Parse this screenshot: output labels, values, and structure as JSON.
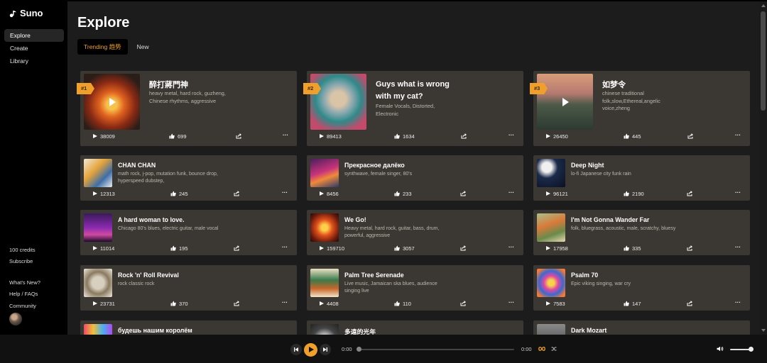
{
  "app": {
    "name": "Suno"
  },
  "sidebar": {
    "nav": [
      {
        "label": "Explore",
        "active": true
      },
      {
        "label": "Create",
        "active": false
      },
      {
        "label": "Library",
        "active": false
      }
    ],
    "credits": "100 credits",
    "subscribe": "Subscribe",
    "links": [
      "What's New?",
      "Help / FAQs",
      "Community"
    ]
  },
  "page": {
    "title": "Explore",
    "tabs": [
      {
        "label": "Trending 趋势",
        "active": true
      },
      {
        "label": "New",
        "active": false
      }
    ]
  },
  "featured": [
    {
      "rank": "#1",
      "title": "醉打蔣門神",
      "tags": [
        "heavy metal, hard rock, guzheng,",
        "Chinese rhythms, aggressive"
      ],
      "plays": "38009",
      "likes": "699"
    },
    {
      "rank": "#2",
      "title_lines": [
        "Guys what is wrong",
        "with my cat?"
      ],
      "tags": [
        "Female Vocals, Distorted,",
        "Electronic"
      ],
      "plays": "89413",
      "likes": "1634"
    },
    {
      "rank": "#3",
      "title": "如梦令",
      "tags": [
        "chinese traditional",
        "folk,slow,Ethereal,angelic",
        "voice,zheng"
      ],
      "plays": "26450",
      "likes": "445"
    }
  ],
  "songs": [
    {
      "title": "CHAN CHAN",
      "tags": [
        "math rock, j-pop, mutation funk, bounce drop,",
        "hyperspeed dubstep,"
      ],
      "plays": "12313",
      "likes": "245"
    },
    {
      "title": "Прекрасное далёко",
      "tags": [
        "synthwave, female singer, 80's"
      ],
      "plays": "8456",
      "likes": "233"
    },
    {
      "title": "Deep Night",
      "tags": [
        "lo-fi Japanese city funk rain"
      ],
      "plays": "96121",
      "likes": "2190"
    },
    {
      "title": "A hard woman to love.",
      "tags": [
        "Chicago 80's blues, electric guitar, male vocal"
      ],
      "plays": "11014",
      "likes": "195"
    },
    {
      "title": "We Go!",
      "tags": [
        "Heavy metal, hard rock, guitar, bass, drum,",
        "powerful, aggressive"
      ],
      "plays": "159710",
      "likes": "3057"
    },
    {
      "title": "I'm Not Gonna Wander Far",
      "tags": [
        "folk, bluegrass, acoustic, male, scratchy, bluesy"
      ],
      "plays": "17958",
      "likes": "335"
    },
    {
      "title": "Rock 'n' Roll Revival",
      "tags": [
        "rock classic rock"
      ],
      "plays": "23731",
      "likes": "370"
    },
    {
      "title": "Palm Tree Serenade",
      "tags": [
        "Live music, Jamaican ska blues, audience",
        "singing live"
      ],
      "plays": "4408",
      "likes": "110"
    },
    {
      "title": "Psalm 70",
      "tags": [
        "Epic viking singing, war cry"
      ],
      "plays": "7583",
      "likes": "147"
    },
    {
      "title": "будешь нашим королём",
      "tags": [],
      "plays": "",
      "likes": ""
    },
    {
      "title": "多遠的光年",
      "tags": [],
      "plays": "",
      "likes": ""
    },
    {
      "title": "Dark Mozart",
      "tags": [],
      "plays": "",
      "likes": ""
    }
  ],
  "player": {
    "elapsed": "0:00",
    "duration": "0:00",
    "progress": 0,
    "volume": 0.85
  },
  "colors": {
    "accent": "#f0a02a",
    "card": "#3b3732",
    "main_bg": "#1c1c1c",
    "sidebar_bg": "#000000"
  },
  "icons": [
    "suno-logo-icon",
    "play-icon",
    "thumbs-up-icon",
    "share-icon",
    "more-icon",
    "skip-back-icon",
    "skip-forward-icon",
    "loop-icon",
    "shuffle-icon",
    "volume-icon"
  ]
}
